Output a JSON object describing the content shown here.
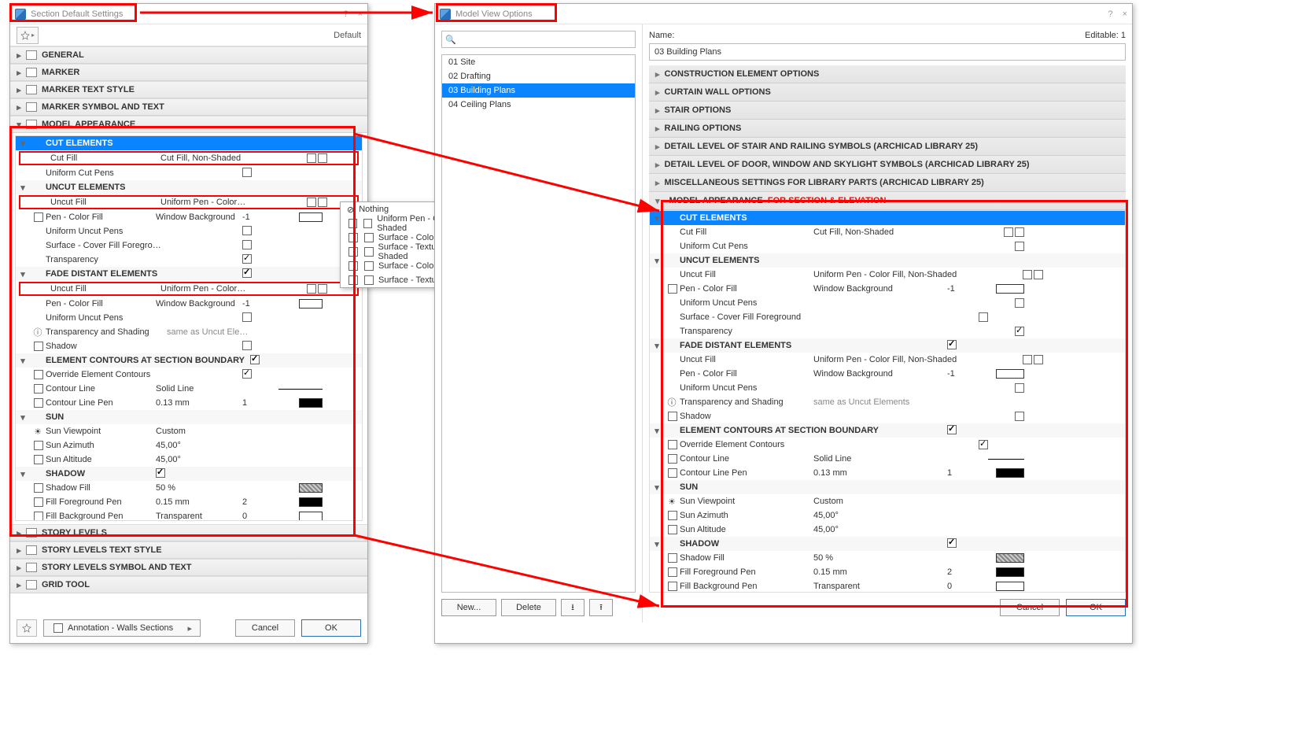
{
  "left_dialog": {
    "title": "Section Default Settings",
    "sys": {
      "help": "?",
      "close": "×"
    },
    "toolbar": {
      "default_label": "Default"
    },
    "panels": {
      "general": "GENERAL",
      "marker": "MARKER",
      "marker_text_style": "MARKER TEXT STYLE",
      "marker_symbol_text": "MARKER SYMBOL AND TEXT",
      "model_appearance": "MODEL APPEARANCE",
      "story_levels": "STORY LEVELS",
      "story_levels_text_style": "STORY LEVELS TEXT STYLE",
      "story_levels_symbol_text": "STORY LEVELS SYMBOL AND TEXT",
      "grid_tool": "GRID TOOL"
    },
    "ma": {
      "cut_elements": "CUT ELEMENTS",
      "cut_fill": {
        "lbl": "Cut Fill",
        "val": "Cut Fill, Non-Shaded"
      },
      "uniform_cut_pens": "Uniform Cut Pens",
      "uncut_elements": "UNCUT ELEMENTS",
      "uncut_fill": {
        "lbl": "Uncut Fill",
        "val": "Uniform Pen - Color Fi…"
      },
      "pen_color_fill": {
        "lbl": "Pen - Color Fill",
        "val": "Window Background",
        "num": "-1"
      },
      "uniform_uncut_pens": "Uniform Uncut Pens",
      "surface_cover": "Surface - Cover Fill Foregro…",
      "transparency": "Transparency",
      "fade": "FADE DISTANT ELEMENTS",
      "fade_uncut_fill": {
        "lbl": "Uncut Fill",
        "val": "Uniform Pen - Color Fi…"
      },
      "fade_pen": {
        "lbl": "Pen - Color Fill",
        "val": "Window Background",
        "num": "-1"
      },
      "fade_uniform_uncut_pens": "Uniform Uncut Pens",
      "trans_shade": {
        "lbl": "Transparency and Shading",
        "val": "same as Uncut Elements"
      },
      "shadow_lbl": "Shadow",
      "contours": "ELEMENT CONTOURS AT SECTION BOUNDARY",
      "override_contours": "Override Element Contours",
      "contour_line": {
        "lbl": "Contour Line",
        "val": "Solid Line"
      },
      "contour_pen": {
        "lbl": "Contour Line Pen",
        "val": "0.13 mm",
        "num": "1"
      },
      "sun": "SUN",
      "sun_vp": {
        "lbl": "Sun Viewpoint",
        "val": "Custom"
      },
      "sun_az": {
        "lbl": "Sun Azimuth",
        "val": "45,00°"
      },
      "sun_alt": {
        "lbl": "Sun Altitude",
        "val": "45,00°"
      },
      "sh": "SHADOW",
      "sh_fill": {
        "lbl": "Shadow Fill",
        "val": "50 %"
      },
      "sh_fg": {
        "lbl": "Fill Foreground Pen",
        "val": "0.15 mm",
        "num": "2"
      },
      "sh_bg": {
        "lbl": "Fill Background Pen",
        "val": "Transparent",
        "num": "0"
      }
    },
    "footer": {
      "fav": "Annotation - Walls Sections",
      "cancel": "Cancel",
      "ok": "OK"
    }
  },
  "popup": {
    "nothing": "Nothing",
    "o1": "Uniform Pen - Color Fill, Non-Shaded",
    "o2": "Surface - Color Fill, Non-Shaded",
    "o3": "Surface - Texture Fill, Non-Shaded",
    "o4": "Surface - Color Fill, Shaded",
    "o5": "Surface - Texture Fill, Shaded"
  },
  "right_dialog": {
    "title": "Model View Options",
    "sys": {
      "help": "?",
      "close": "×"
    },
    "search_placeholder": "",
    "name_label": "Name:",
    "editable": "Editable: 1",
    "name_value": "03 Building Plans",
    "list": [
      "01 Site",
      "02 Drafting",
      "03 Building Plans",
      "04 Ceiling Plans"
    ],
    "panels": [
      "CONSTRUCTION ELEMENT OPTIONS",
      "CURTAIN WALL OPTIONS",
      "STAIR OPTIONS",
      "RAILING OPTIONS",
      "DETAIL LEVEL OF STAIR AND RAILING SYMBOLS (ARCHICAD LIBRARY 25)",
      "DETAIL LEVEL OF DOOR, WINDOW AND SKYLIGHT SYMBOLS (ARCHICAD LIBRARY 25)",
      "MISCELLANEOUS SETTINGS FOR LIBRARY PARTS (ARCHICAD LIBRARY 25)"
    ],
    "ma_title": "MODEL APPEARANCE",
    "ma_extra": "FOR SECTION & ELEVATION",
    "ma": {
      "cut_elements": "CUT ELEMENTS",
      "cut_fill": {
        "lbl": "Cut Fill",
        "val": "Cut Fill, Non-Shaded"
      },
      "uniform_cut_pens": "Uniform Cut Pens",
      "uncut_elements": "UNCUT ELEMENTS",
      "uncut_fill": {
        "lbl": "Uncut Fill",
        "val": "Uniform Pen - Color Fill, Non-Shaded"
      },
      "pen_color_fill": {
        "lbl": "Pen - Color Fill",
        "val": "Window Background",
        "num": "-1"
      },
      "uniform_uncut_pens": "Uniform Uncut Pens",
      "surface_cover": "Surface - Cover Fill Foreground",
      "transparency": "Transparency",
      "fade": "FADE DISTANT ELEMENTS",
      "fade_uncut_fill": {
        "lbl": "Uncut Fill",
        "val": "Uniform Pen - Color Fill, Non-Shaded"
      },
      "fade_pen": {
        "lbl": "Pen - Color Fill",
        "val": "Window Background",
        "num": "-1"
      },
      "fade_uniform_uncut_pens": "Uniform Uncut Pens",
      "trans_shade": {
        "lbl": "Transparency and Shading",
        "val": "same as Uncut Elements"
      },
      "shadow_lbl": "Shadow",
      "contours": "ELEMENT CONTOURS AT SECTION BOUNDARY",
      "override_contours": "Override Element Contours",
      "contour_line": {
        "lbl": "Contour Line",
        "val": "Solid Line"
      },
      "contour_pen": {
        "lbl": "Contour Line Pen",
        "val": "0.13 mm",
        "num": "1"
      },
      "sun": "SUN",
      "sun_vp": {
        "lbl": "Sun Viewpoint",
        "val": "Custom"
      },
      "sun_az": {
        "lbl": "Sun Azimuth",
        "val": "45,00°"
      },
      "sun_alt": {
        "lbl": "Sun Altitude",
        "val": "45,00°"
      },
      "sh": "SHADOW",
      "sh_fill": {
        "lbl": "Shadow Fill",
        "val": "50 %"
      },
      "sh_fg": {
        "lbl": "Fill Foreground Pen",
        "val": "0.15 mm",
        "num": "2"
      },
      "sh_bg": {
        "lbl": "Fill Background Pen",
        "val": "Transparent",
        "num": "0"
      }
    },
    "footer": {
      "new": "New...",
      "delete": "Delete",
      "cancel": "Cancel",
      "ok": "OK"
    }
  }
}
